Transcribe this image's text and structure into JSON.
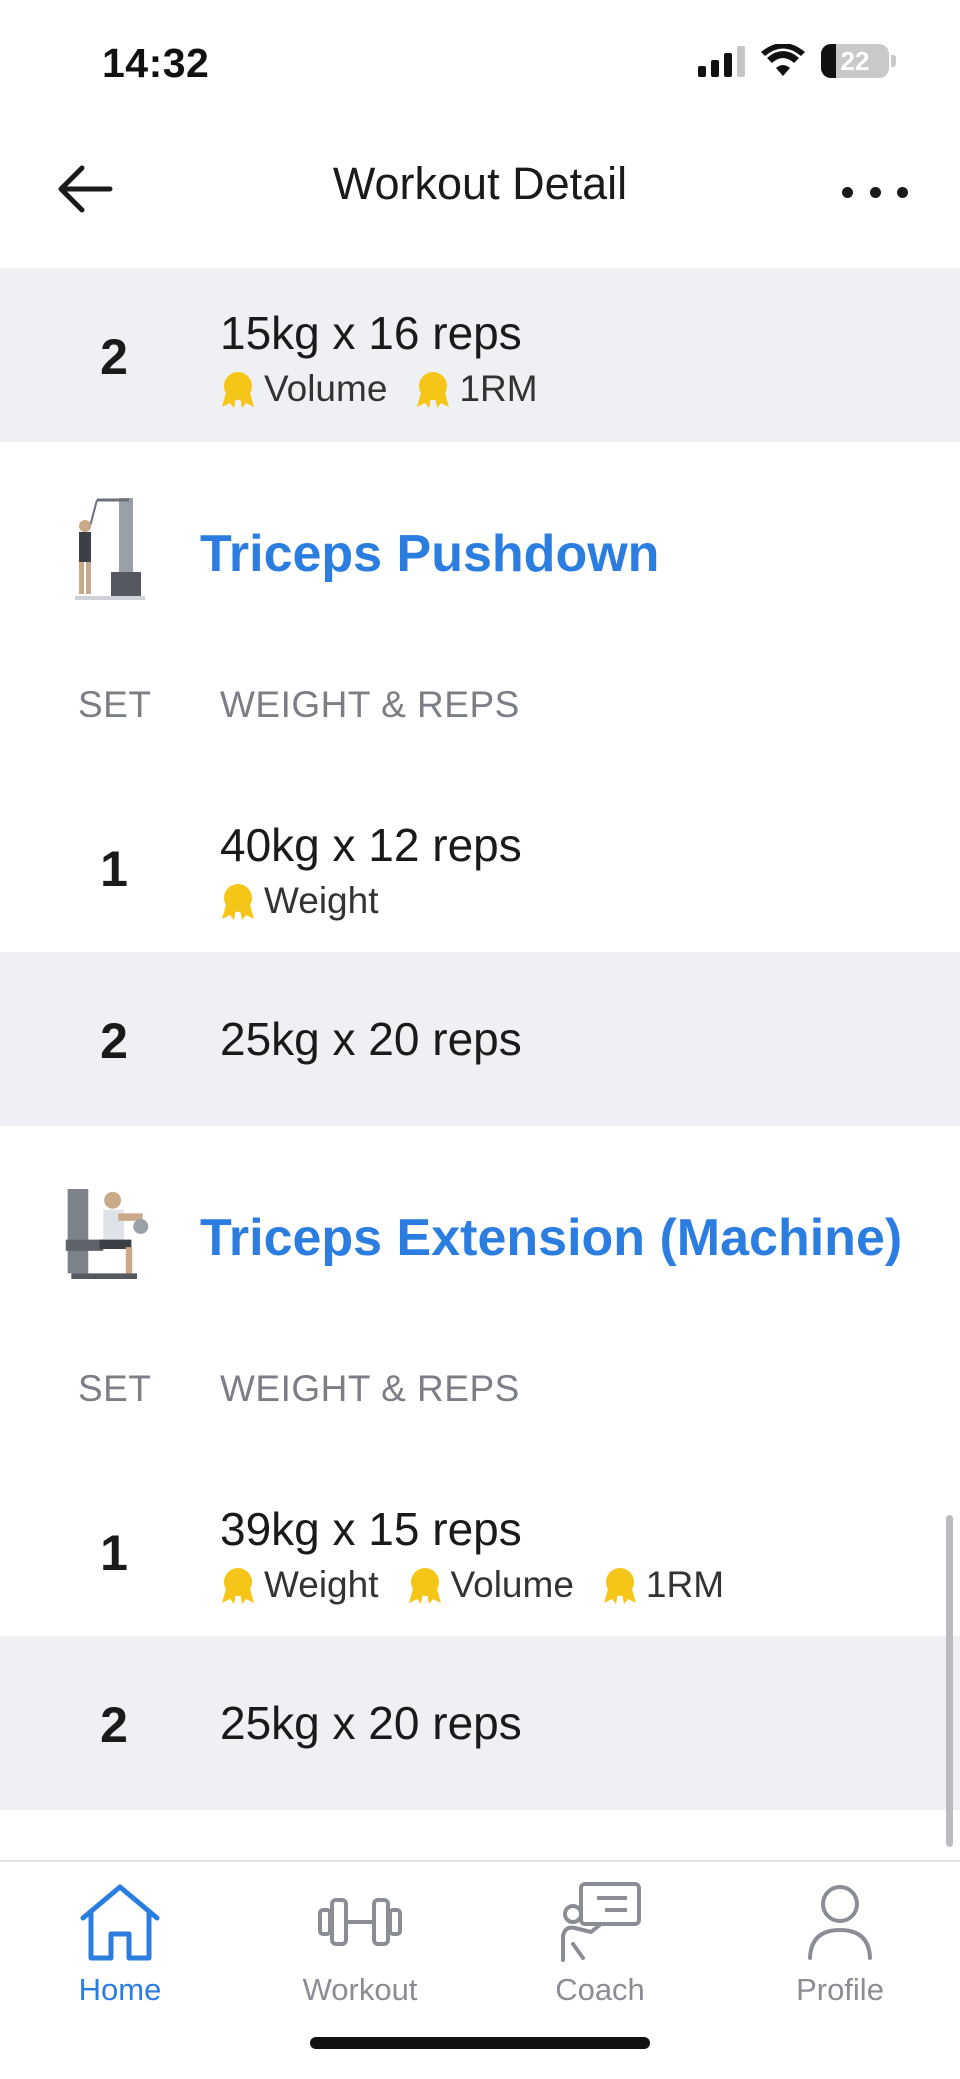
{
  "status_bar": {
    "time": "14:32",
    "battery_level": "22",
    "icons": [
      "signal-icon",
      "wifi-icon",
      "battery-icon"
    ]
  },
  "nav": {
    "title": "Workout Detail",
    "back_icon": "arrow-left-icon",
    "more_icon": "more-horizontal-icon"
  },
  "top_row": {
    "set": "2",
    "weight_reps": "15kg x 16 reps",
    "badges": [
      "Volume",
      "1RM"
    ]
  },
  "exercises": [
    {
      "name": "Triceps Pushdown",
      "col_set": "SET",
      "col_weight_reps": "WEIGHT & REPS",
      "sets": [
        {
          "set": "1",
          "weight_reps": "40kg x 12 reps",
          "badges": [
            "Weight"
          ]
        },
        {
          "set": "2",
          "weight_reps": "25kg x 20 reps",
          "badges": []
        }
      ]
    },
    {
      "name": "Triceps Extension (Machine)",
      "col_set": "SET",
      "col_weight_reps": "WEIGHT & REPS",
      "sets": [
        {
          "set": "1",
          "weight_reps": "39kg x 15 reps",
          "badges": [
            "Weight",
            "Volume",
            "1RM"
          ]
        },
        {
          "set": "2",
          "weight_reps": "25kg x 20 reps",
          "badges": []
        }
      ]
    }
  ],
  "tab_bar": {
    "items": [
      {
        "label": "Home",
        "icon": "home-icon",
        "active": true
      },
      {
        "label": "Workout",
        "icon": "dumbbell-icon",
        "active": false
      },
      {
        "label": "Coach",
        "icon": "coach-icon",
        "active": false
      },
      {
        "label": "Profile",
        "icon": "profile-icon",
        "active": false
      }
    ]
  },
  "colors": {
    "accent": "#2b7de0",
    "row_shade": "#eef0f4",
    "medal": "#f5c518",
    "muted": "#7b7e85"
  }
}
